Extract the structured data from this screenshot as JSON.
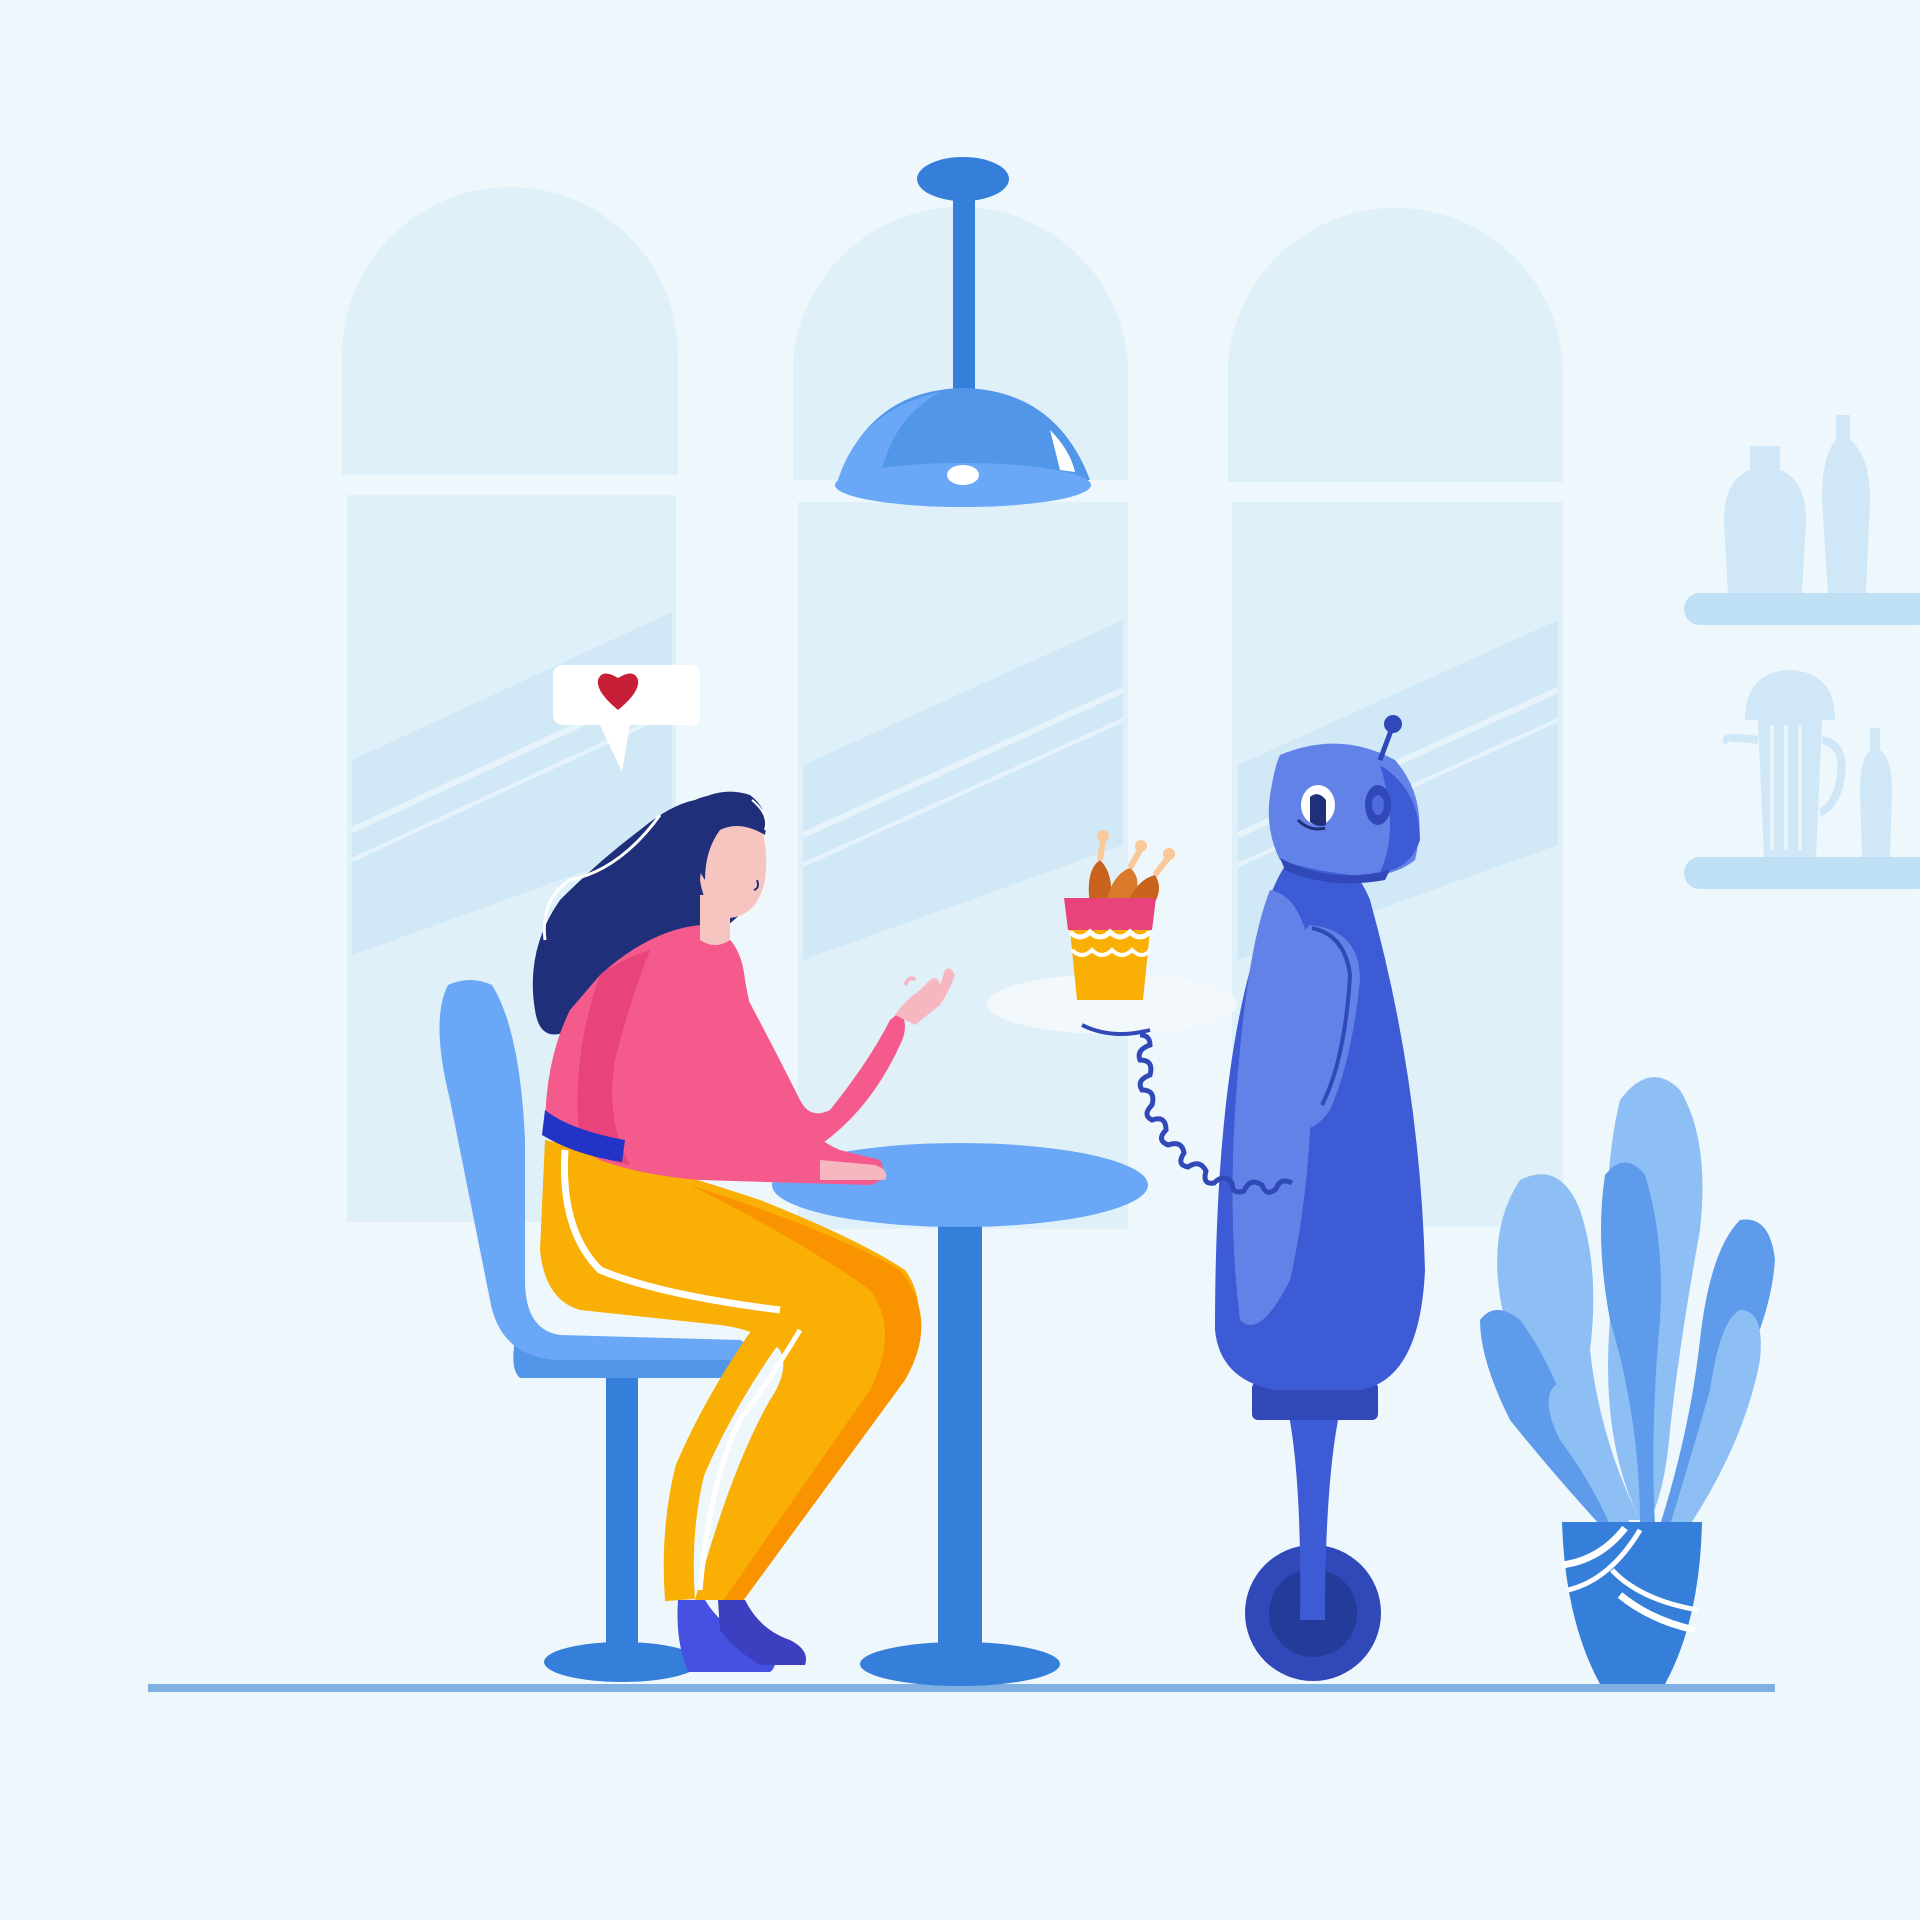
{
  "scene": {
    "description_free": true,
    "colors": {
      "background": "#EEF7FC",
      "window_pane": "#DFF0F9",
      "window_glass": "#CFE8F7",
      "floor_line": "#7FB0E4",
      "furniture_blue": "#6AA8F7",
      "furniture_dark": "#357FDB",
      "robot_body": "#3E5BD6",
      "robot_light": "#6382E8",
      "sweater_pink": "#F55A8C",
      "pants_yellow": "#F9AF04",
      "hair_navy": "#1F2F7A",
      "heart_red": "#C71F37",
      "plant_blue": "#8DBFF5"
    },
    "icons": {
      "speech_bubble": "heart-icon",
      "lamp": "pendant-lamp-icon"
    }
  }
}
